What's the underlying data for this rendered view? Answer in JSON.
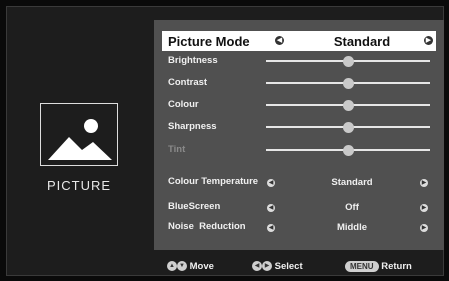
{
  "section": {
    "title": "PICTURE",
    "icon": "picture-icon"
  },
  "header": {
    "label": "Picture Mode",
    "value": "Standard"
  },
  "sliders": [
    {
      "label": "Brightness",
      "level_pct": 50,
      "enabled": true
    },
    {
      "label": "Contrast",
      "level_pct": 50,
      "enabled": true
    },
    {
      "label": "Colour",
      "level_pct": 50,
      "enabled": true
    },
    {
      "label": "Sharpness",
      "level_pct": 50,
      "enabled": true
    },
    {
      "label": "Tint",
      "level_pct": 50,
      "enabled": false
    }
  ],
  "options": [
    {
      "label": "Colour Temperature",
      "value": "Standard"
    },
    {
      "label": "BlueScreen",
      "value": "Off"
    },
    {
      "label": "Noise  Reduction",
      "value": "Middle"
    }
  ],
  "footer": {
    "move": "Move",
    "select": "Select",
    "menu_key": "MENU",
    "return": "Return"
  }
}
